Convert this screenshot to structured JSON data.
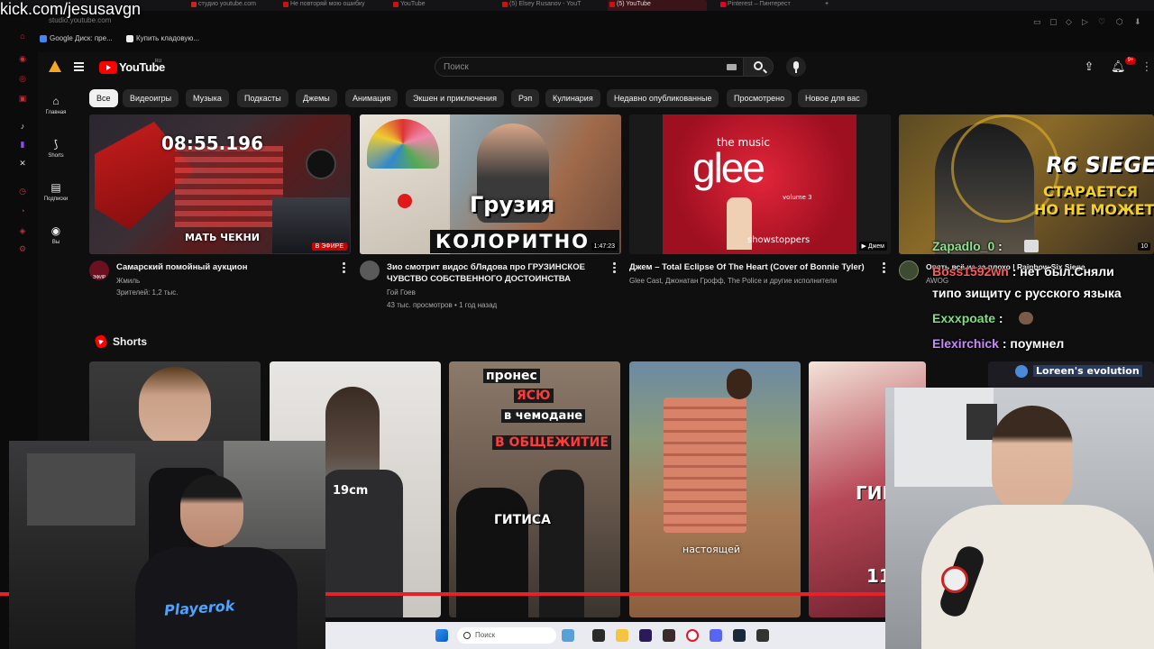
{
  "stream": {
    "watermark": "kick.com/jesusavgn",
    "chat": [
      {
        "user": "Zapadlo_0",
        "sep": " : ",
        "text": "",
        "color": "#8de38d"
      },
      {
        "user": "Boss1592wn",
        "sep": " : ",
        "text": "нет был.Сняли",
        "color": "#ff5a5a"
      },
      {
        "user": "",
        "sep": "",
        "text": "типо зищиту с русского языка",
        "color": "#ffffff"
      },
      {
        "user": "Exxxpoate",
        "sep": " : ",
        "text": "",
        "color": "#7ee07e"
      },
      {
        "user": "Elexirchick",
        "sep": " : ",
        "text": "поумнел",
        "color": "#c889ff"
      }
    ],
    "shirt_text": "Playerok"
  },
  "browser": {
    "url_text": "studio.youtube.com",
    "tabs": [
      {
        "label": "студио youtube.com"
      },
      {
        "label": "Не повторяй мою ошибку"
      },
      {
        "label": "YouTube"
      },
      {
        "label": "(5) Elsey Rusanov - YouT"
      },
      {
        "label": "(5) YouTube"
      },
      {
        "label": "Pinterest – Пинтерест"
      }
    ],
    "bookmarks": [
      {
        "label": "Google Диск: пре...",
        "color": "#4285f4"
      },
      {
        "label": "Купить кладовую...",
        "color": "#eeeeee"
      }
    ]
  },
  "youtube": {
    "logo_text": "YouTube",
    "country_code": "RU",
    "search_placeholder": "Поиск",
    "notifications_count": "9+",
    "guide": [
      {
        "icon": "home-icon",
        "label": "Главная"
      },
      {
        "icon": "shorts-icon",
        "label": "Shorts"
      },
      {
        "icon": "subscriptions-icon",
        "label": "Подписки"
      },
      {
        "icon": "you-icon",
        "label": "Вы"
      }
    ],
    "chips": [
      "Все",
      "Видеоигры",
      "Музыка",
      "Подкасты",
      "Джемы",
      "Анимация",
      "Экшен и приключения",
      "Рэп",
      "Кулинария",
      "Недавно опубликованные",
      "Просмотрено",
      "Новое для вас"
    ],
    "videos": [
      {
        "title": "Самарский помойный аукцион",
        "channel": "Жмиль",
        "meta": "Зрителей: 1,2 тыс.",
        "badge": "В ЭФИРЕ",
        "thumb_timer": "08:55.196",
        "thumb_caption": "МАТЬ ЧЕКНИ",
        "avatar_text": "ЭФИР"
      },
      {
        "title": "Зио смотрит видос бЛядова про ГРУЗИНСКОЕ ЧУВСТВО СОБСТВЕННОГО ДОСТОИНСТВА",
        "channel": "Гой Гоев",
        "meta": "43 тыс. просмотров • 1 год назад",
        "duration": "1:47:23",
        "thumb_text_1": "Грузия",
        "thumb_text_2": "КОЛОРИТНО"
      },
      {
        "title": "Джем – Total Eclipse Of The Heart (Cover of Bonnie Tyler)",
        "channel": "Glee Cast, Джонатан Грофф, The Police и другие исполнители",
        "meta": "",
        "badge_text": "Джем",
        "thumb_text_1": "the music",
        "thumb_text_2": "glee",
        "thumb_text_3": "volume 3",
        "thumb_text_4": "showstoppers"
      },
      {
        "title": "Опять всё из-за плохо | Rainbow Six Siege",
        "channel": "AWOG",
        "meta": "",
        "duration": "10",
        "thumb_text_1": "R6 SIEGE",
        "thumb_text_2": "СТАРАЕТСЯ",
        "thumb_text_3": "НО НЕ МОЖЕТ"
      }
    ],
    "shorts_title": "Shorts",
    "shorts": [
      {
        "caption": ""
      },
      {
        "caption": "19cm"
      },
      {
        "caption_lines": [
          "пронес",
          "ЯСЮ",
          "в чемодане",
          "В ОБЩЕЖИТИЕ"
        ],
        "caption_bottom": "ГИТИСА"
      },
      {
        "caption": "настоящей"
      },
      {
        "caption": "ГИГ",
        "caption_2": "11"
      },
      {
        "caption": "Loreen's evolution"
      }
    ]
  },
  "taskbar": {
    "search_placeholder": "Поиск"
  }
}
